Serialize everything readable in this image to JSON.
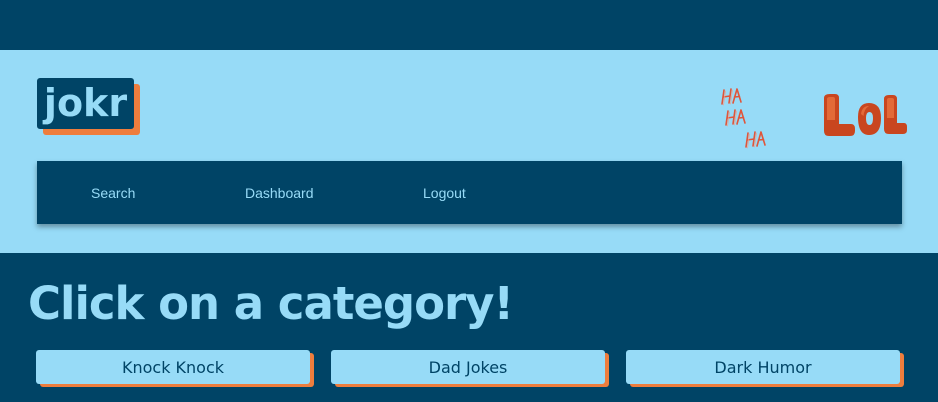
{
  "brand": {
    "logo_text": "jokr"
  },
  "stickers": {
    "haha_text": "HA HA HA",
    "lol_text": "LOL"
  },
  "nav": {
    "items": [
      {
        "label": "Search"
      },
      {
        "label": "Dashboard"
      },
      {
        "label": "Logout"
      }
    ]
  },
  "main": {
    "title": "Click on a category!",
    "categories": [
      {
        "label": "Knock Knock"
      },
      {
        "label": "Dad Jokes"
      },
      {
        "label": "Dark Humor"
      }
    ]
  },
  "colors": {
    "dark_navy": "#004466",
    "light_blue": "#97dbf7",
    "accent_orange": "#ee7d3d",
    "sticker_red": "#d9472b"
  }
}
